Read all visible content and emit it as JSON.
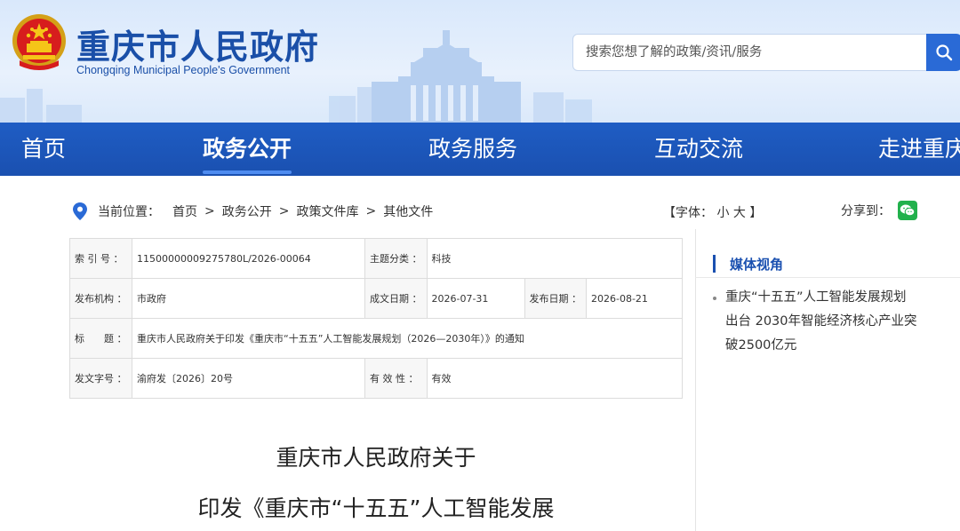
{
  "site": {
    "title": "重庆市人民政府",
    "subtitle": "Chongqing Municipal People's Government"
  },
  "search": {
    "placeholder": "搜索您想了解的政策/资讯/服务",
    "icon": "search-icon"
  },
  "nav": {
    "items": [
      "首页",
      "政务公开",
      "政务服务",
      "互动交流",
      "走进重庆"
    ],
    "active_index": 1
  },
  "breadcrumb": {
    "label": "当前位置：",
    "items": [
      "首页",
      "政务公开",
      "政策文件库",
      "其他文件"
    ],
    "separator": ">"
  },
  "font_size": {
    "label": "【字体：",
    "small": "小",
    "large": "大",
    "close": "】"
  },
  "share": {
    "label": "分享到：",
    "icon": "wechat-icon"
  },
  "info": {
    "index_no_label": "索 引 号 ：",
    "index_no": "11500000009275780L/2026-00064",
    "topic_label": "主题分类 ：",
    "topic": "科技",
    "issuer_label": "发布机构 ：",
    "issuer": "市政府",
    "created_label": "成文日期 ：",
    "created": "2026-07-31",
    "published_label": "发布日期 ：",
    "published": "2026-08-21",
    "title_label": "标　　题 ：",
    "title": "重庆市人民政府关于印发《重庆市“十五五”人工智能发展规划（2026—2030年）》的通知",
    "doc_no_label": "发文字号 ：",
    "doc_no": "渝府发〔2026〕20号",
    "validity_label": "有 效 性 ：",
    "validity": "有效"
  },
  "side": {
    "title": "媒体视角",
    "news": "重庆“十五五”人工智能发展规划出台 2030年智能经济核心产业突破2500亿元"
  },
  "article": {
    "title_line1": "重庆市人民政府关于",
    "title_line2": "印发《重庆市“十五五”人工智能发展"
  },
  "colors": {
    "brand": "#1a50b0",
    "nav_bg": "#1f5dc4",
    "accent": "#2a6ad6",
    "wechat": "#22b14c"
  }
}
